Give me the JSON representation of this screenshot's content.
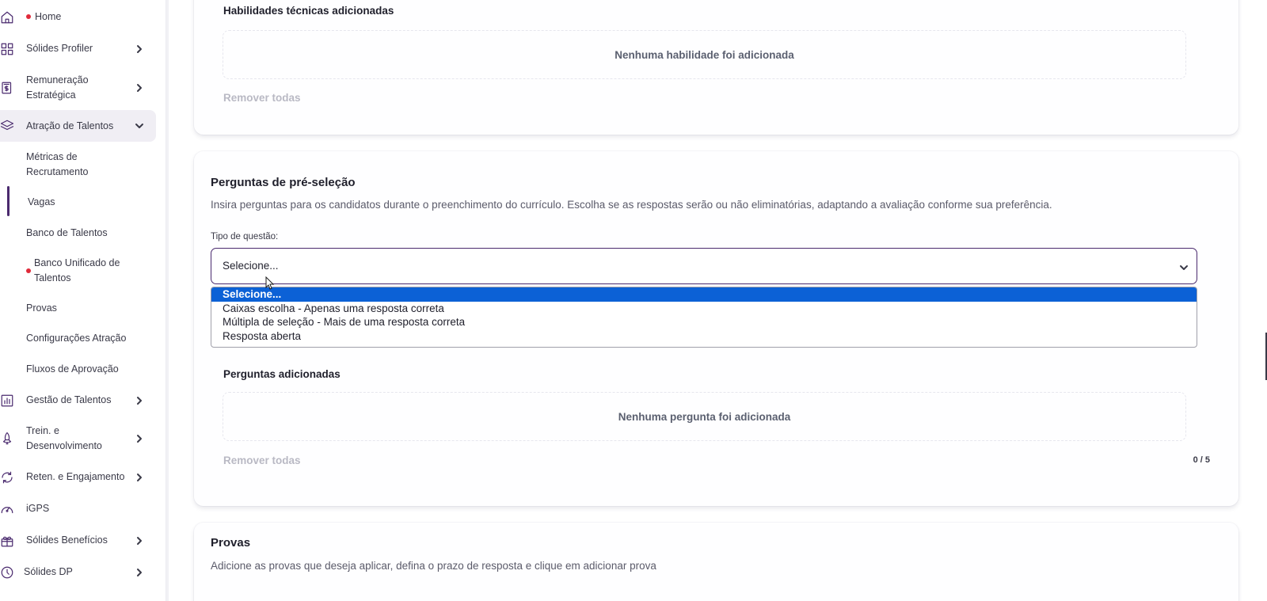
{
  "sidebar": {
    "items": [
      {
        "label": "Home",
        "icon": "home-icon",
        "has_dot": true
      },
      {
        "label": "Sólides Profiler",
        "icon": "grid-icon"
      },
      {
        "label": "Remuneração\nEstratégica",
        "icon": "money-doc-icon"
      },
      {
        "label": "Atração de Talentos",
        "icon": "layers-icon",
        "expanded": true
      },
      {
        "label": "Gestão de Talentos",
        "icon": "bar-chart-icon"
      },
      {
        "label": "Trein. e\nDesenvolvimento",
        "icon": "rocket-icon"
      },
      {
        "label": "Reten. e Engajamento",
        "icon": "refresh-icon"
      },
      {
        "label": "iGPS",
        "icon": "gauge-icon"
      },
      {
        "label": "Sólides Benefícios",
        "icon": "gift-icon"
      },
      {
        "label": "Sólides DP",
        "icon": "clock-icon"
      }
    ],
    "subitems": [
      {
        "label": "Métricas de\nRecrutamento"
      },
      {
        "label": "Vagas",
        "active": true
      },
      {
        "label": "Banco de Talentos"
      },
      {
        "label": "Banco Unificado de\nTalentos",
        "has_dot": true
      },
      {
        "label": "Provas"
      },
      {
        "label": "Configurações Atração"
      },
      {
        "label": "Fluxos de Aprovação"
      }
    ]
  },
  "skills_card": {
    "title": "Habilidades técnicas adicionadas",
    "empty": "Nenhuma habilidade foi adicionada",
    "remove_all": "Remover todas"
  },
  "preselect_card": {
    "title": "Perguntas de pré-seleção",
    "description": "Insira perguntas para os candidatos durante o preenchimento do currículo. Escolha se as respostas serão ou não eliminatórias, adaptando a avaliação conforme sua preferência.",
    "field_label": "Tipo de questão:",
    "select_value": "Selecione...",
    "options": [
      "Selecione...",
      "Caixas escolha - Apenas uma resposta correta",
      "Múltipla de seleção - Mais de uma resposta correta",
      "Resposta aberta"
    ],
    "added_title": "Perguntas adicionadas",
    "empty": "Nenhuma pergunta foi adicionada",
    "remove_all": "Remover todas",
    "counter": "0 / 5"
  },
  "tests_card": {
    "title": "Provas",
    "description": "Adicione as provas que deseja aplicar, defina o prazo de resposta e clique em adicionar prova"
  },
  "colors": {
    "brand": "#4a2a6e",
    "selected_option": "#0c61d6",
    "dot": "#e02a3a"
  }
}
